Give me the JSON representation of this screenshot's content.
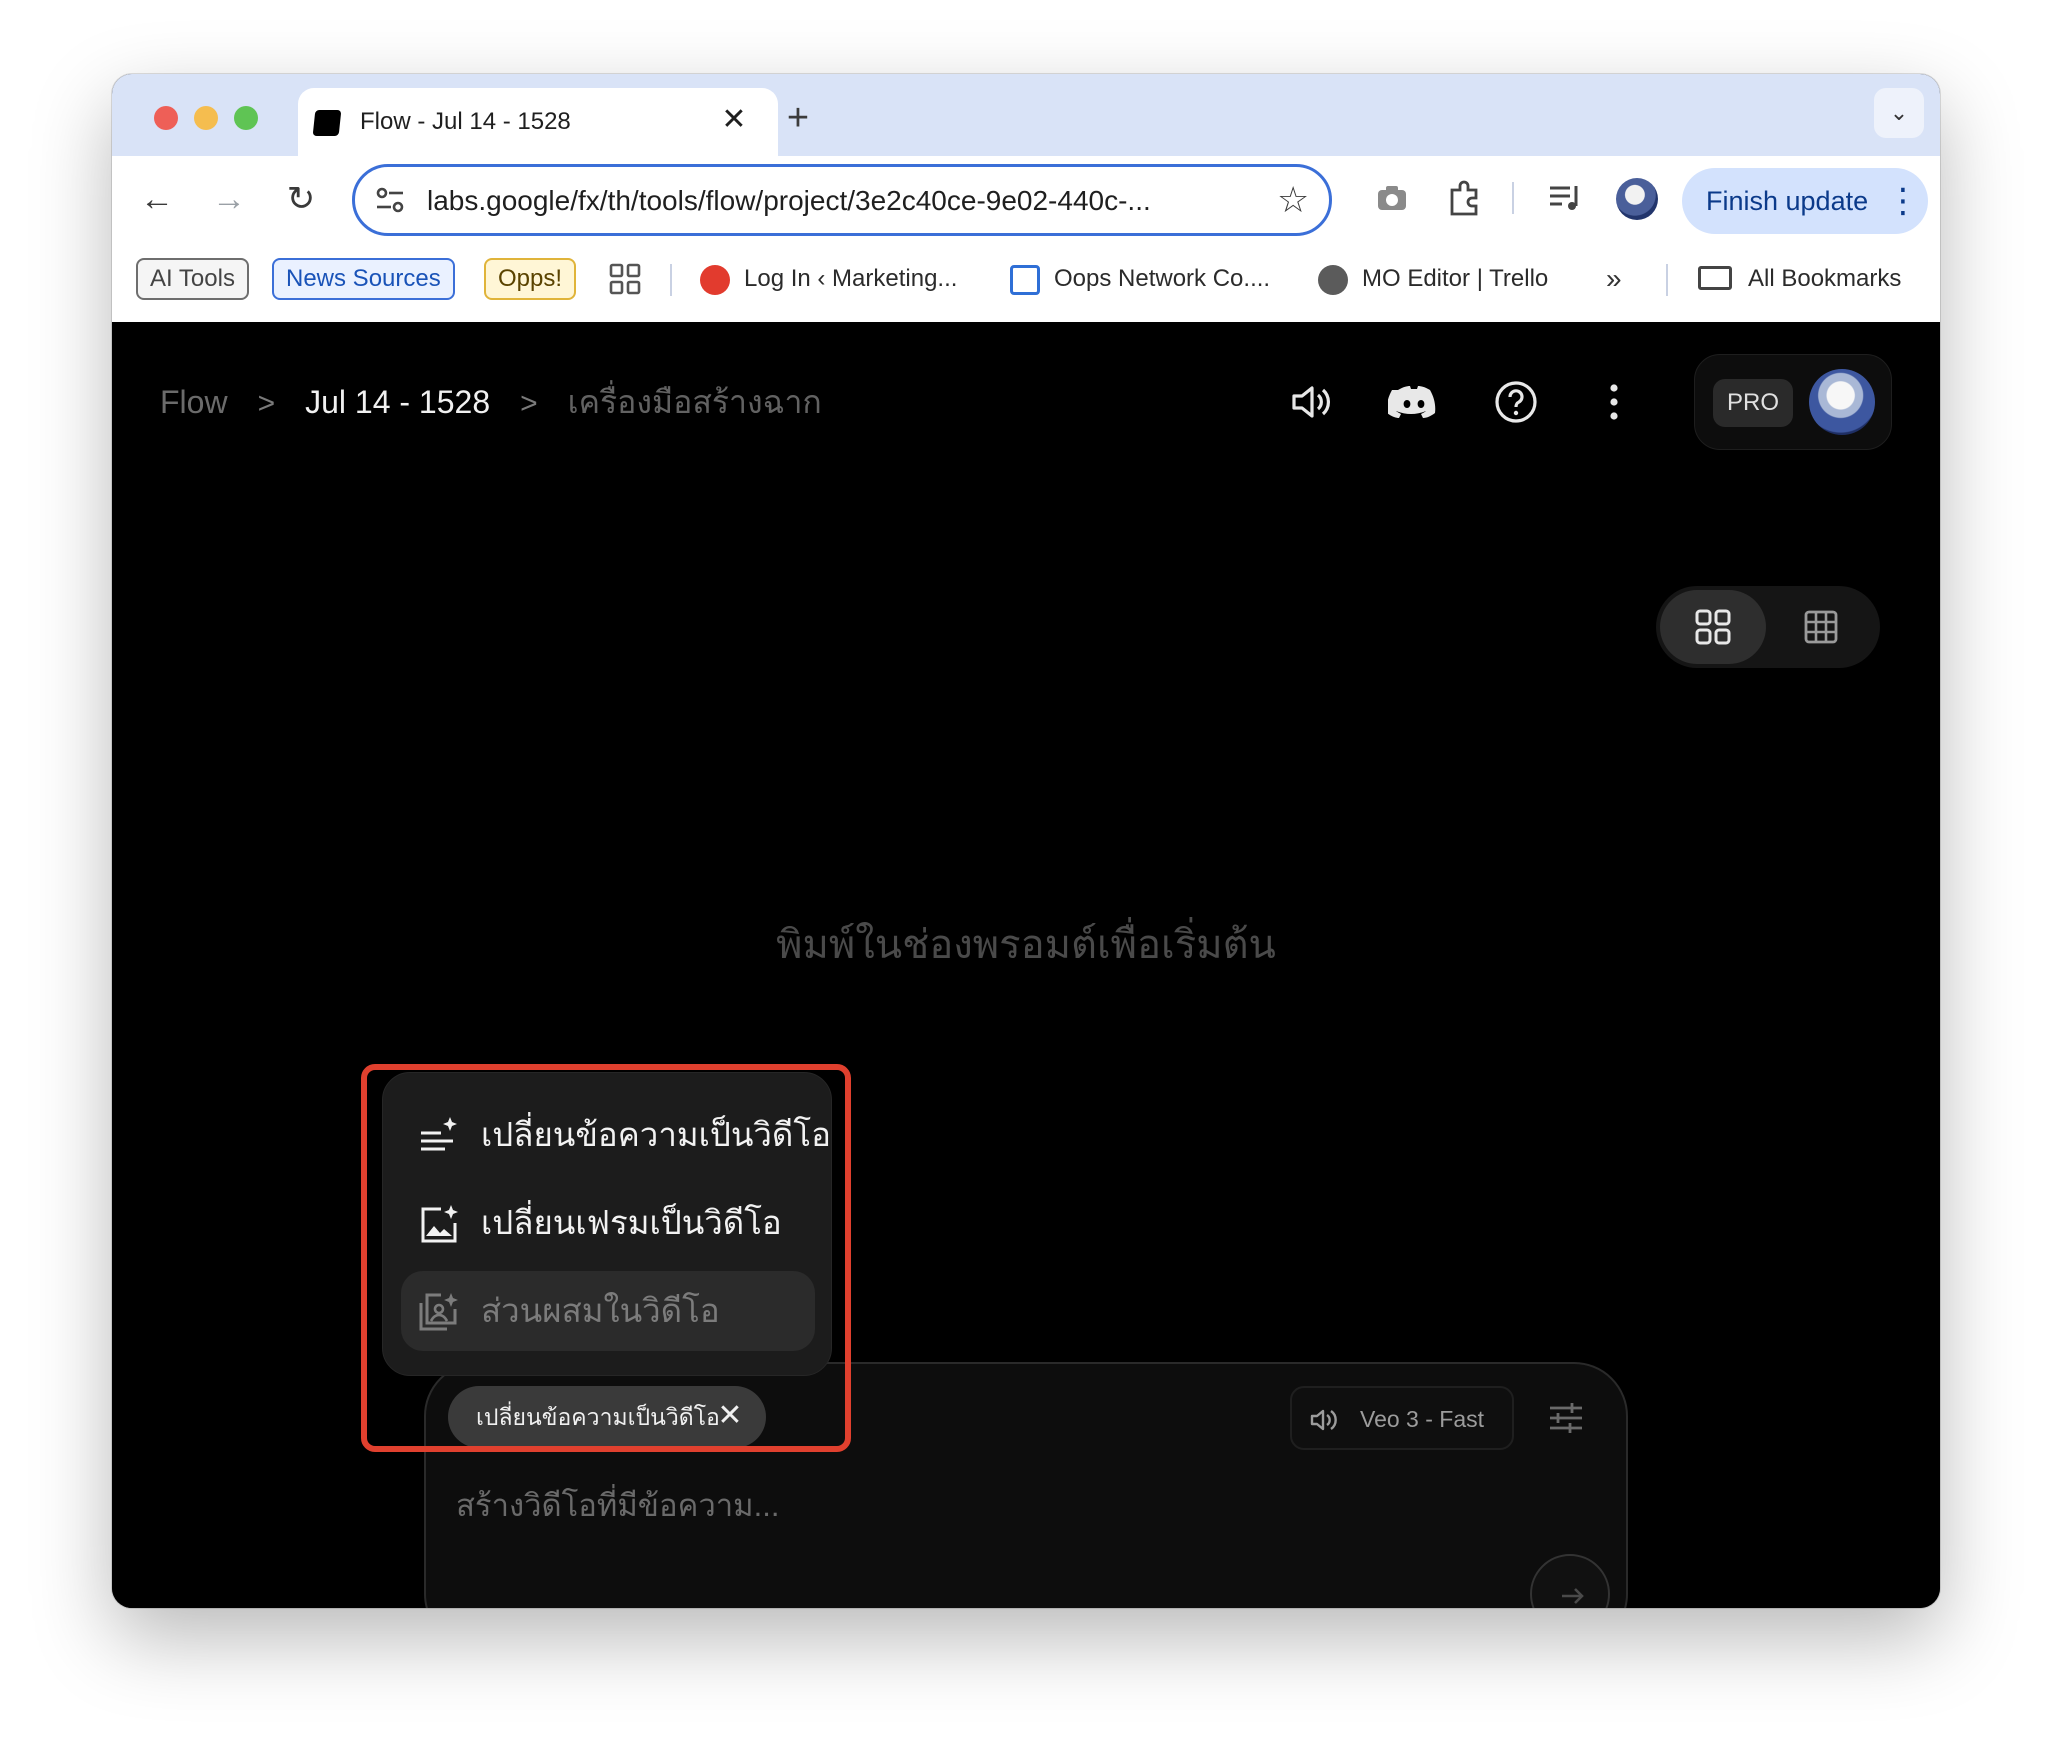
{
  "browser": {
    "tab": {
      "title": "Flow - Jul 14 - 1528",
      "close_glyph": "✕"
    },
    "new_tab_glyph": "+",
    "tab_search_glyph": "⌄",
    "nav": {
      "back": "←",
      "forward": "→",
      "reload": "↻"
    },
    "url": "labs.google/fx/th/tools/flow/project/3e2c40ce-9e02-440c-...",
    "bookmark_star": "☆",
    "finish_update": "Finish update",
    "menu_glyph": "⋮",
    "bookmarks": {
      "chips": [
        "AI Tools",
        "News Sources",
        "Opps!"
      ],
      "items": [
        "Log In ‹ Marketing...",
        "Oops Network Co....",
        "MO Editor | Trello"
      ],
      "more": "»",
      "all_bookmarks": "All Bookmarks"
    }
  },
  "app": {
    "breadcrumb": [
      "Flow",
      "Jul 14 - 1528",
      "เครื่องมือสร้างฉาก"
    ],
    "breadcrumb_sep": ">",
    "plan_badge": "PRO",
    "empty_message": "พิมพ์ในช่องพรอมต์เพื่อเริ่มต้น",
    "mode_menu": [
      {
        "label": "เปลี่ยนข้อความเป็นวิดีโอ",
        "icon": "text-sparkle-icon",
        "enabled": true
      },
      {
        "label": "เปลี่ยนเฟรมเป็นวิดีโอ",
        "icon": "image-sparkle-icon",
        "enabled": true
      },
      {
        "label": "ส่วนผสมในวิดีโอ",
        "icon": "images-sparkle-icon",
        "enabled": false
      }
    ],
    "composer": {
      "mode_chip": "เปลี่ยนข้อความเป็นวิดีโอ",
      "mode_chip_close": "✕",
      "model": "Veo 3 - Fast",
      "prompt_value": "",
      "placeholder": "สร้างวิดีโอที่มีข้อความ..."
    }
  },
  "colors": {
    "app_bg": "#000000",
    "highlight": "#e0402e",
    "accent_blue": "#3b6fd8",
    "finish_bg": "#d3e2fd"
  }
}
